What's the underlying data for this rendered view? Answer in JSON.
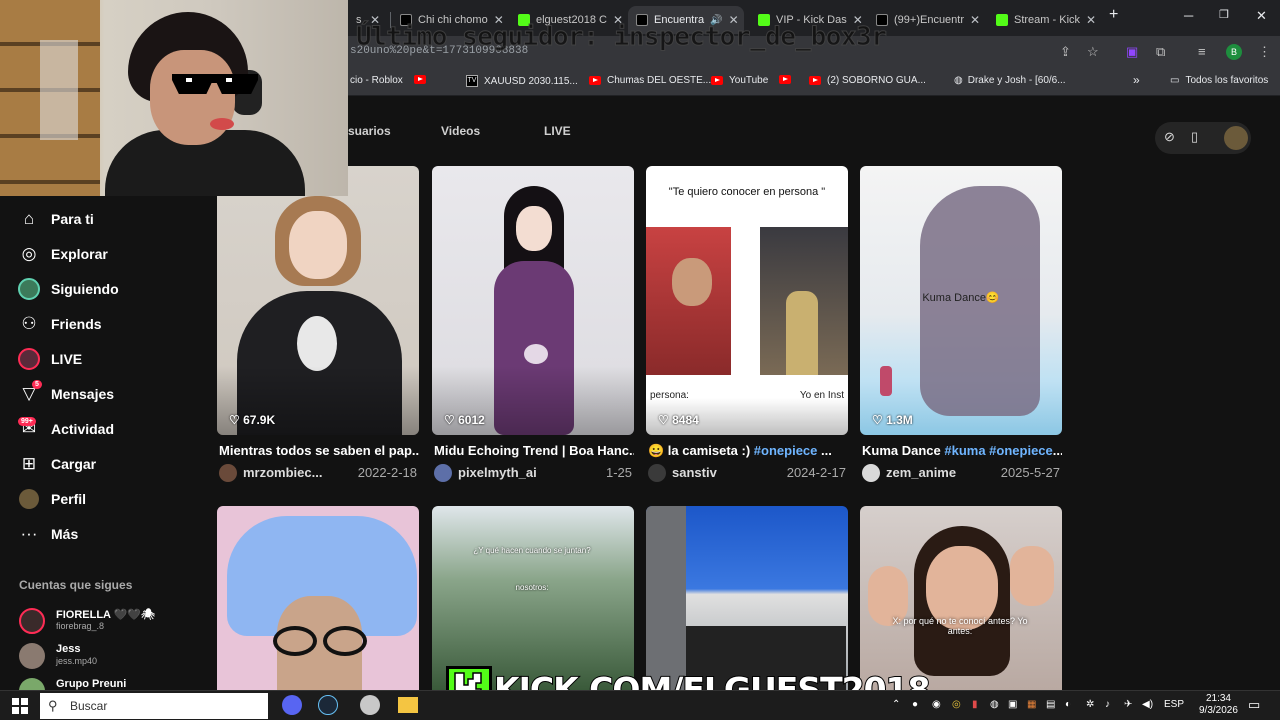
{
  "browser": {
    "tabs": [
      {
        "label": "Chi chi chomo",
        "fav": "#000000"
      },
      {
        "label": "elguest2018 C",
        "fav": "#53fc18"
      },
      {
        "label": "Encuentra",
        "fav": "#000000",
        "active": true
      },
      {
        "label": "VIP - Kick Das",
        "fav": "#53fc18"
      },
      {
        "label": "(99+)Encuentr",
        "fav": "#000000"
      },
      {
        "label": "Stream - Kick",
        "fav": "#53fc18"
      }
    ],
    "url": "s20uno%20pe&t=1773109908838",
    "bookmarks": [
      {
        "label": "cio - Roblox",
        "icon": "none"
      },
      {
        "label": "",
        "icon": "youtube"
      },
      {
        "label": "XAUUSD 2030.115...",
        "icon": "tradingview"
      },
      {
        "label": "Chumas DEL OESTE...",
        "icon": "youtube"
      },
      {
        "label": "YouTube",
        "icon": "youtube"
      },
      {
        "label": "",
        "icon": "youtube"
      },
      {
        "label": "(2) SOBORNO GUA...",
        "icon": "youtube"
      },
      {
        "label": "Drake y Josh - [60/6...",
        "icon": "globe"
      }
    ],
    "all_bookmarks": "Todos los favoritos",
    "profile_initial": "B"
  },
  "overlay_title": "Último seguidor: inspector_de_box3r",
  "sidebar": {
    "items": [
      {
        "label": "Para ti",
        "icon": "home-icon"
      },
      {
        "label": "Explorar",
        "icon": "compass-icon"
      },
      {
        "label": "Siguiendo",
        "icon": "following-avatar-icon"
      },
      {
        "label": "Friends",
        "icon": "friends-icon"
      },
      {
        "label": "LIVE",
        "icon": "live-icon"
      },
      {
        "label": "Mensajes",
        "icon": "messages-icon",
        "badge": "5"
      },
      {
        "label": "Actividad",
        "icon": "activity-icon",
        "badge": "99+"
      },
      {
        "label": "Cargar",
        "icon": "upload-icon"
      },
      {
        "label": "Perfil",
        "icon": "profile-icon"
      },
      {
        "label": "Más",
        "icon": "more-icon"
      }
    ],
    "following_title": "Cuentas que sigues",
    "accounts": [
      {
        "name": "FIORELLA 🖤🖤🕷",
        "handle": "fiorebrag_.8"
      },
      {
        "name": "Jess",
        "handle": "jess.mp40"
      },
      {
        "name": "Grupo Preuni",
        "handle": ""
      }
    ]
  },
  "page_tabs": [
    "suarios",
    "Videos",
    "LIVE"
  ],
  "videos": [
    {
      "title": "Mientras todos se saben el pap...",
      "user": "mrzombiec...",
      "date": "2022-2-18",
      "likes": "67.9K"
    },
    {
      "title": "Midu Echoing Trend | Boa Hanc...",
      "user": "pixelmyth_ai",
      "date": "1-25",
      "likes": "6012"
    },
    {
      "title_prefix": "😀 la camiseta :) ",
      "title_tag": "#onepiece",
      "title_suffix": " ...",
      "user": "sanstiv",
      "date": "2024-2-17",
      "likes": "8484",
      "thumb_text_top": "\"Te quiero conocer en persona \"",
      "thumb_text_left": "persona:",
      "thumb_text_right": "Yo en Inst"
    },
    {
      "title_prefix": "Kuma Dance ",
      "title_tag": "#kuma #onepiece",
      "title_suffix": "...",
      "user": "zem_anime",
      "date": "2025-5-27",
      "likes": "1.3M",
      "thumb_text": "Kuma Dance😊"
    },
    {
      "thumb_text": ""
    },
    {
      "thumb_text": "¿Y qué hacen cuando se juntan?",
      "thumb_text2": "nosotros:"
    },
    {
      "thumb_text": ""
    },
    {
      "thumb_text": "X: por qué no te conocí antes? Yo antes:"
    }
  ],
  "kick_banner": "KICK.COM/ELGUEST2018",
  "taskbar": {
    "search_label": "Buscar",
    "lang": "ESP",
    "time": "21:34",
    "date": "9/3/2026"
  }
}
